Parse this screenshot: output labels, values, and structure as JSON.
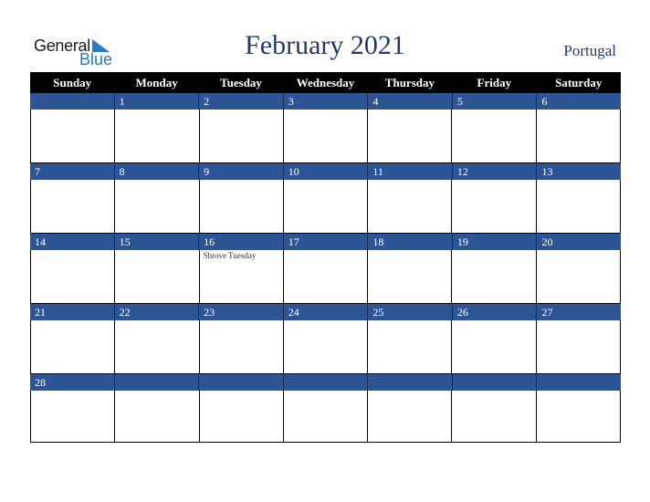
{
  "logo": {
    "line1": "General",
    "line2": "Blue"
  },
  "title": "February 2021",
  "country": "Portugal",
  "colors": {
    "accent": "#2d5596",
    "header_bg": "#000000",
    "title": "#233a66",
    "logo_blue": "#2a7bc1"
  },
  "weekdays": [
    "Sunday",
    "Monday",
    "Tuesday",
    "Wednesday",
    "Thursday",
    "Friday",
    "Saturday"
  ],
  "weeks": [
    {
      "days": [
        "",
        "1",
        "2",
        "3",
        "4",
        "5",
        "6"
      ],
      "events": [
        "",
        "",
        "",
        "",
        "",
        "",
        ""
      ]
    },
    {
      "days": [
        "7",
        "8",
        "9",
        "10",
        "11",
        "12",
        "13"
      ],
      "events": [
        "",
        "",
        "",
        "",
        "",
        "",
        ""
      ]
    },
    {
      "days": [
        "14",
        "15",
        "16",
        "17",
        "18",
        "19",
        "20"
      ],
      "events": [
        "",
        "",
        "Shrove Tuesday",
        "",
        "",
        "",
        ""
      ]
    },
    {
      "days": [
        "21",
        "22",
        "23",
        "24",
        "25",
        "26",
        "27"
      ],
      "events": [
        "",
        "",
        "",
        "",
        "",
        "",
        ""
      ]
    },
    {
      "days": [
        "28",
        "",
        "",
        "",
        "",
        "",
        ""
      ],
      "events": [
        "",
        "",
        "",
        "",
        "",
        "",
        ""
      ]
    }
  ]
}
